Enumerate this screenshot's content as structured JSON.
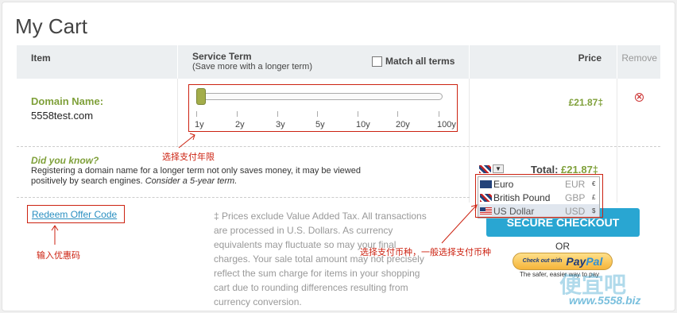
{
  "page_title": "My Cart",
  "header": {
    "item": "Item",
    "service_term": "Service Term",
    "service_term_sub": "(Save more with a longer term)",
    "match_all_terms": "Match all terms",
    "price": "Price",
    "remove": "Remove"
  },
  "cart_item": {
    "label": "Domain Name:",
    "domain": "5558test.com",
    "price": "£21.87‡",
    "slider_value_years": 1,
    "term_options": [
      "1y",
      "2y",
      "3y",
      "5y",
      "10y",
      "20y",
      "100y"
    ]
  },
  "did_you_know": {
    "title": "Did you know?",
    "body": "Registering a domain name for a longer term not only saves money, it may be viewed positively by search engines.",
    "body_em": "Consider a 5-year term."
  },
  "total": {
    "label": "Total:",
    "value": "£21.87‡"
  },
  "currency_menu": [
    {
      "name": "Euro",
      "code": "EUR",
      "symbol": "€",
      "flag": "eu-flag-icon"
    },
    {
      "name": "British Pound",
      "code": "GBP",
      "symbol": "£",
      "flag": "uk-flag-icon"
    },
    {
      "name": "US Dollar",
      "code": "USD",
      "symbol": "$",
      "flag": "us-flag-icon",
      "highlighted": true
    }
  ],
  "redeem_offer": "Redeem Offer Code",
  "vat_note": "‡ Prices exclude Value Added Tax. All transactions are processed in U.S. Dollars. As currency equivalents may fluctuate so may your final charges. Your sale total amount may not precisely reflect the sum charge for items in your shopping cart due to rounding differences resulting from currency conversion.",
  "checkout_button": "SECURE CHECKOUT",
  "or_text": "OR",
  "paypal": {
    "small": "Check out with",
    "logo_a": "Pay",
    "logo_b": "Pal",
    "tagline": "The safer, easier way to pay"
  },
  "annotations": {
    "term": "选择支付年限",
    "currency": "选择支付币种，一般选择支付币种",
    "coupon": "输入优惠码"
  },
  "watermark": {
    "brand": "便宜吧",
    "url": "www.5558.biz"
  },
  "colors": {
    "accent_green": "#7fa03a",
    "link_blue": "#2a8fc1",
    "checkout_blue": "#29a6d2",
    "annotation_red": "#c21"
  }
}
